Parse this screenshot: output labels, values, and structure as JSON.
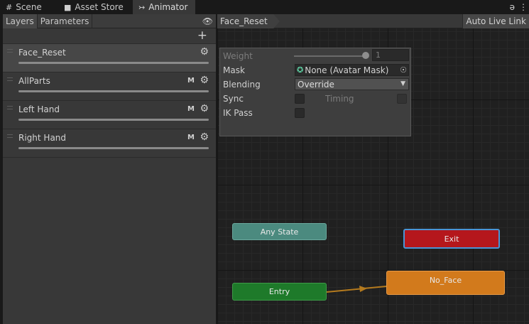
{
  "tabs": [
    {
      "label": "Scene",
      "icon": "grid-icon"
    },
    {
      "label": "Asset Store",
      "icon": "store-bag-icon"
    },
    {
      "label": "Animator",
      "icon": "animator-icon"
    }
  ],
  "left_panel": {
    "tabs": [
      "Layers",
      "Parameters"
    ],
    "layers": [
      {
        "name": "Face_Reset",
        "badge": "",
        "selected": true
      },
      {
        "name": "AllParts",
        "badge": "M",
        "selected": false
      },
      {
        "name": "Left Hand",
        "badge": "M",
        "selected": false
      },
      {
        "name": "Right Hand",
        "badge": "M",
        "selected": false
      }
    ]
  },
  "graph": {
    "breadcrumb": "Face_Reset",
    "auto_live_link": "Auto Live Link"
  },
  "settings": {
    "weight_label": "Weight",
    "weight_value": "1",
    "mask_label": "Mask",
    "mask_value": "None (Avatar Mask)",
    "blending_label": "Blending",
    "blending_value": "Override",
    "sync_label": "Sync",
    "timing_label": "Timing",
    "ikpass_label": "IK Pass"
  },
  "nodes": {
    "any_state": "Any State",
    "exit": "Exit",
    "no_face": "No_Face",
    "entry": "Entry"
  },
  "colors": {
    "any_state": "#4b8a7f",
    "exit": "#b5171c",
    "default_state": "#d27a1c",
    "entry": "#1e7a2a",
    "transition": "#b47a1e"
  }
}
